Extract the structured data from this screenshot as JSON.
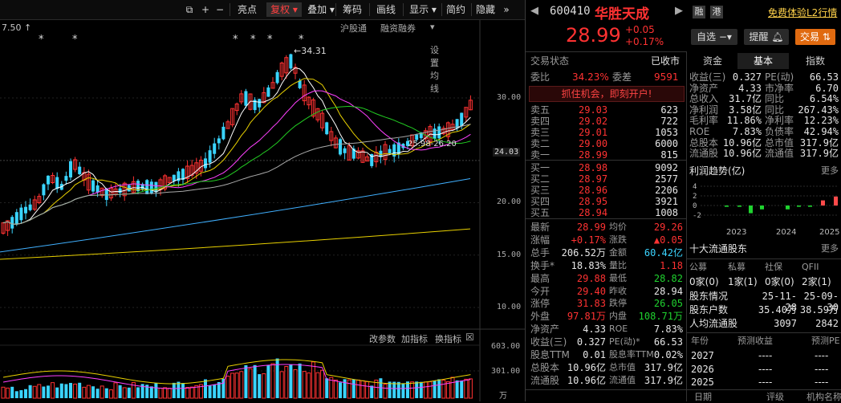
{
  "toolbar": {
    "items": [
      "亮点",
      "复权",
      "叠加",
      "筹码",
      "画线",
      "显示",
      "简约",
      "隐藏"
    ],
    "chevrons": "»",
    "plus": "+",
    "minus": "−"
  },
  "subbar": {
    "items": [
      "沪股通",
      "融资融券",
      "设置均线"
    ],
    "left_price": "7.50",
    "left_arrow": "↑"
  },
  "chart": {
    "high_label": "34.31",
    "range_label": "25.98-26.20",
    "y_ticks": [
      "30.00",
      "24.03",
      "20.00",
      "15.00",
      "10.00"
    ],
    "vol_ticks": [
      "603.00",
      "301.00",
      "万"
    ],
    "bottom_links": [
      "改参数",
      "加指标",
      "换指标"
    ],
    "stars": [
      "*",
      "*",
      "*",
      "*",
      "*",
      "*"
    ]
  },
  "stock": {
    "code": "600410",
    "name": "华胜天成",
    "price": "28.99",
    "change": "+0.05",
    "change_pct": "+0.17%",
    "tag1": "融",
    "tag2": "港",
    "promo": "免费体验L2行情",
    "watch_btn": "自选",
    "remind_btn": "提醒",
    "trade_btn": "交易"
  },
  "status": {
    "label": "交易状态",
    "value": "已收市",
    "webi_label": "委比",
    "webi": "34.23%",
    "weicha_label": "委差",
    "weicha": "9591",
    "banner": "抓住机会，即刻开户!"
  },
  "order_book": {
    "sells": [
      {
        "label": "卖五",
        "price": "29.03",
        "vol": "623"
      },
      {
        "label": "卖四",
        "price": "29.02",
        "vol": "722"
      },
      {
        "label": "卖三",
        "price": "29.01",
        "vol": "1053"
      },
      {
        "label": "卖二",
        "price": "29.00",
        "vol": "6000"
      },
      {
        "label": "卖一",
        "price": "28.99",
        "vol": "815"
      }
    ],
    "buys": [
      {
        "label": "买一",
        "price": "28.98",
        "vol": "9092"
      },
      {
        "label": "买二",
        "price": "28.97",
        "vol": "2577"
      },
      {
        "label": "买三",
        "price": "28.96",
        "vol": "2206"
      },
      {
        "label": "买四",
        "price": "28.95",
        "vol": "3921"
      },
      {
        "label": "买五",
        "price": "28.94",
        "vol": "1008"
      }
    ]
  },
  "quote_stats": [
    {
      "l1": "最新",
      "v1": "28.99",
      "c1": "red",
      "l2": "均价",
      "v2": "29.26",
      "c2": "red"
    },
    {
      "l1": "涨幅",
      "v1": "+0.17%",
      "c1": "red",
      "l2": "涨跌",
      "v2": "▲0.05",
      "c2": "red"
    },
    {
      "l1": "总手",
      "v1": "206.52万",
      "c1": "wht",
      "l2": "金额",
      "v2": "60.42亿",
      "c2": "cyan"
    },
    {
      "l1": "换手*",
      "v1": "18.83%",
      "c1": "wht",
      "l2": "量比",
      "v2": "1.18",
      "c2": "red"
    },
    {
      "l1": "最高",
      "v1": "29.88",
      "c1": "red",
      "l2": "最低",
      "v2": "28.82",
      "c2": "grn"
    },
    {
      "l1": "今开",
      "v1": "29.40",
      "c1": "red",
      "l2": "昨收",
      "v2": "28.94",
      "c2": "wht"
    },
    {
      "l1": "涨停",
      "v1": "31.83",
      "c1": "red",
      "l2": "跌停",
      "v2": "26.05",
      "c2": "grn"
    },
    {
      "l1": "外盘",
      "v1": "97.81万",
      "c1": "red",
      "l2": "内盘",
      "v2": "108.71万",
      "c2": "grn"
    },
    {
      "l1": "净资产",
      "v1": "4.33",
      "c1": "wht",
      "l2": "ROE",
      "v2": "7.83%",
      "c2": "wht"
    },
    {
      "l1": "收益(三)",
      "v1": "0.327",
      "c1": "wht",
      "l2": "PE(动)*",
      "v2": "66.53",
      "c2": "wht"
    },
    {
      "l1": "股息TTM",
      "v1": "0.01",
      "c1": "wht",
      "l2": "股息率TTM",
      "v2": "0.02%",
      "c2": "wht"
    },
    {
      "l1": "总股本",
      "v1": "10.96亿",
      "c1": "wht",
      "l2": "总市值",
      "v2": "317.9亿",
      "c2": "wht"
    },
    {
      "l1": "流通股",
      "v1": "10.96亿",
      "c1": "wht",
      "l2": "流通值",
      "v2": "317.9亿",
      "c2": "wht"
    }
  ],
  "fund_tabs": [
    "资金",
    "基本",
    "指数"
  ],
  "fundamentals": [
    {
      "l1": "收益(三)",
      "v1": "0.327",
      "l2": "PE(动)",
      "v2": "66.53"
    },
    {
      "l1": "净资产",
      "v1": "4.33",
      "l2": "市净率",
      "v2": "6.70"
    },
    {
      "l1": "总收入",
      "v1": "31.7亿",
      "l2": "同比",
      "v2": "6.54%"
    },
    {
      "l1": "净利润",
      "v1": "3.58亿",
      "l2": "同比",
      "v2": "267.43%"
    },
    {
      "l1": "毛利率",
      "v1": "11.86%",
      "l2": "净利率",
      "v2": "12.23%"
    },
    {
      "l1": "ROE",
      "v1": "7.83%",
      "l2": "负债率",
      "v2": "42.94%"
    },
    {
      "l1": "总股本",
      "v1": "10.96亿",
      "l2": "总市值",
      "v2": "317.9亿"
    },
    {
      "l1": "流通股",
      "v1": "10.96亿",
      "l2": "流通值",
      "v2": "317.9亿"
    }
  ],
  "profit_trend": {
    "title": "利润趋势(亿)",
    "more": "更多",
    "y_ticks": [
      "4",
      "2",
      "0",
      "-2"
    ],
    "x_labels": [
      "2023",
      "2024",
      "2025"
    ]
  },
  "holders": {
    "title": "十大流通股东",
    "more": "更多",
    "headers": [
      "公募",
      "私募",
      "社保",
      "QFII"
    ],
    "values": [
      "0家(0)",
      "1家(1)",
      "0家(0)",
      "2家(1)"
    ],
    "rows": [
      {
        "label": "股东情况",
        "a": "25-11-28",
        "b": "25-09-30"
      },
      {
        "label": "股东户数",
        "a": "35.40万",
        "b": "38.59万"
      },
      {
        "label": "人均流通股",
        "a": "3097",
        "b": "2842"
      }
    ]
  },
  "forecast": {
    "headers": [
      "年份",
      "预测收益",
      "预测PE"
    ],
    "rows": [
      {
        "year": "2027",
        "eps": "----",
        "pe": "----"
      },
      {
        "year": "2026",
        "eps": "----",
        "pe": "----"
      },
      {
        "year": "2025",
        "eps": "----",
        "pe": "----"
      }
    ]
  },
  "bottom_bar": [
    "日期",
    "评级",
    "机构名称"
  ],
  "colors": {
    "up": "#ff3232",
    "down": "#1fd32f",
    "cyan": "#3ad4ff",
    "ma5": "#ffffff",
    "ma10": "#e8d000",
    "ma20": "#ff40ff",
    "ma30": "#22cc22",
    "ma60": "#aaaaaa",
    "ma120": "#40b0ff",
    "ma250": "#e8d000"
  }
}
